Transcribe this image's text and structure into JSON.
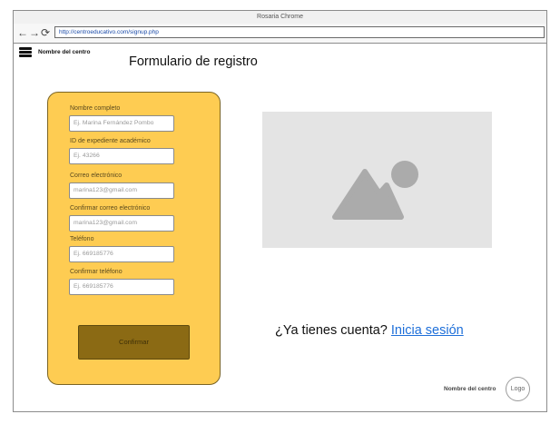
{
  "browser": {
    "window_title": "Rosaria Chrome",
    "url": "http://centroeducativo.com/signup.php",
    "back_icon": "←",
    "forward_icon": "→",
    "reload_icon": "⟳"
  },
  "header": {
    "center_name": "Nombre del centro",
    "page_title": "Formulario de registro"
  },
  "form": {
    "fields": [
      {
        "label": "Nombre completo",
        "placeholder": "Ej. Marina Fernández Pombo"
      },
      {
        "label": "ID de expediente académico",
        "placeholder": "Ej. 43266"
      },
      {
        "label": "Correo electrónico",
        "placeholder": "marina123@gmail.com"
      },
      {
        "label": "Confirmar correo electrónico",
        "placeholder": "marina123@gmail.com"
      },
      {
        "label": "Teléfono",
        "placeholder": "Ej. 669185776"
      },
      {
        "label": "Confirmar teléfono",
        "placeholder": "Ej. 669185776"
      }
    ],
    "confirm_label": "Confirmar"
  },
  "account": {
    "prompt": "¿Ya tienes cuenta? ",
    "login_link": "Inicia sesión"
  },
  "footer": {
    "center_name": "Nombre del centro",
    "logo_text": "Logo"
  },
  "colors": {
    "form_background": "#fecc52",
    "confirm_button": "#8b6a14",
    "link": "#1e6fd9",
    "placeholder_image": "#e4e4e4"
  }
}
